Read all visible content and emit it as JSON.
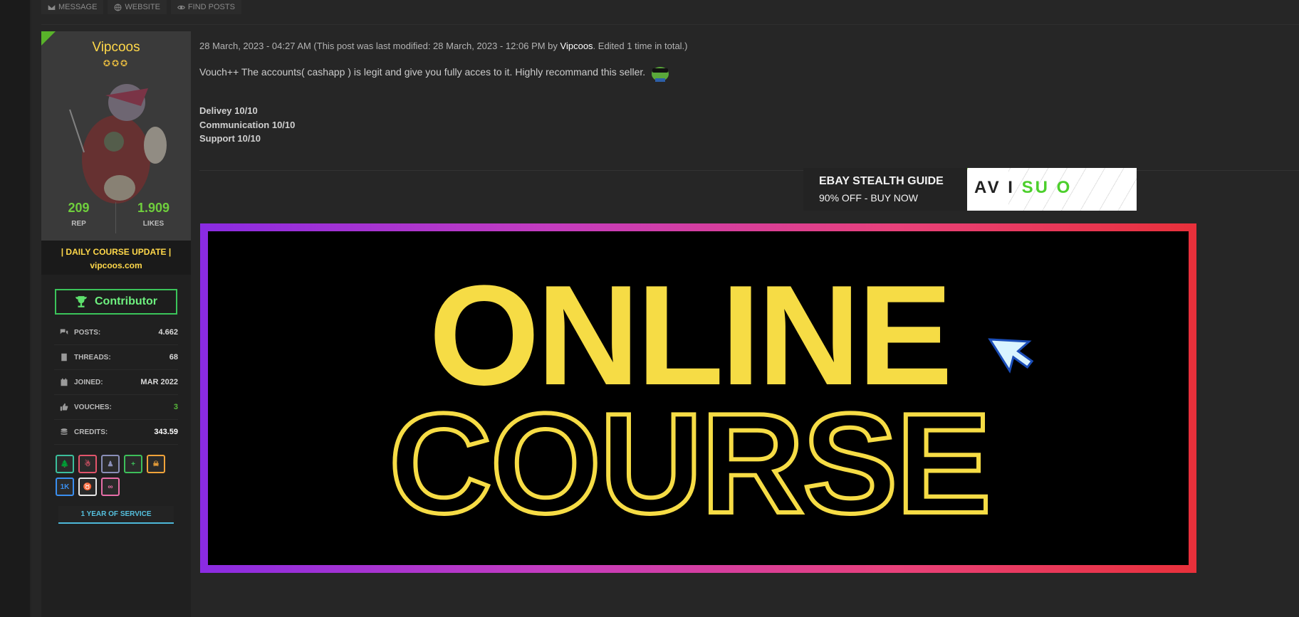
{
  "topbar": {
    "buttons": [
      {
        "label": "MESSAGE",
        "icon": "envelope-icon"
      },
      {
        "label": "WEBSITE",
        "icon": "globe-icon"
      },
      {
        "label": "FIND POSTS",
        "icon": "eye-icon"
      }
    ]
  },
  "user": {
    "name": "Vipcoos",
    "stars": "✪✪✪",
    "rep_value": "209",
    "rep_label": "REP",
    "likes_value": "1.909",
    "likes_label": "LIKES",
    "tagline_line1": "| DAILY COURSE UPDATE |",
    "tagline_line2": "vipcoos.com",
    "rank": "Contributor",
    "info": [
      {
        "icon": "comments-icon",
        "key": "POSTS:",
        "value": "4.662"
      },
      {
        "icon": "book-icon",
        "key": "THREADS:",
        "value": "68"
      },
      {
        "icon": "calendar-icon",
        "key": "JOINED:",
        "value": "MAR 2022"
      },
      {
        "icon": "thumbs-up-icon",
        "key": "VOUCHES:",
        "value": "3"
      },
      {
        "icon": "coins-icon",
        "key": "CREDITS:",
        "value": "343.59"
      }
    ],
    "badges": [
      {
        "name": "tree-badge",
        "glyph": "🌲",
        "color": "#3bbf9c"
      },
      {
        "name": "character-badge",
        "glyph": "☃",
        "color": "#e2556b"
      },
      {
        "name": "ninja-badge",
        "glyph": "♟",
        "color": "#8a8fb8"
      },
      {
        "name": "plus-badge",
        "glyph": "+",
        "color": "#3dbf5a"
      },
      {
        "name": "skull-badge",
        "glyph": "☠",
        "color": "#f0a33a"
      },
      {
        "name": "1k-badge",
        "glyph": "1K",
        "color": "#3a8ff0"
      },
      {
        "name": "horns-badge",
        "glyph": "♉",
        "color": "#e6e6e6"
      },
      {
        "name": "infinity-badge",
        "glyph": "∞",
        "color": "#e86ea8"
      }
    ],
    "service": "1 YEAR OF SERVICE"
  },
  "post": {
    "meta_prefix": "28 March, 2023 - 04:27 AM (This post was last modified: 28 March, 2023 - 12:06 PM by ",
    "meta_author": "Vipcoos",
    "meta_suffix": ". Edited 1 time in total.)",
    "body": "Vouch++  The accounts( cashapp ) is legit and give you fully acces to it. Highly recommand this seller.",
    "ratings": [
      "Delivey 10/10",
      "Communication 10/10",
      "Support 10/10"
    ]
  },
  "ad": {
    "title": "EBAY STEALTH GUIDE",
    "subtitle": "90% OFF - BUY NOW",
    "brand_a": "A",
    "brand_b": "V",
    "brand_c": "I",
    "brand_d": "SU",
    "brand_e": "O"
  },
  "course_banner": {
    "line1": "ONLINE",
    "line2": "COURSE"
  }
}
